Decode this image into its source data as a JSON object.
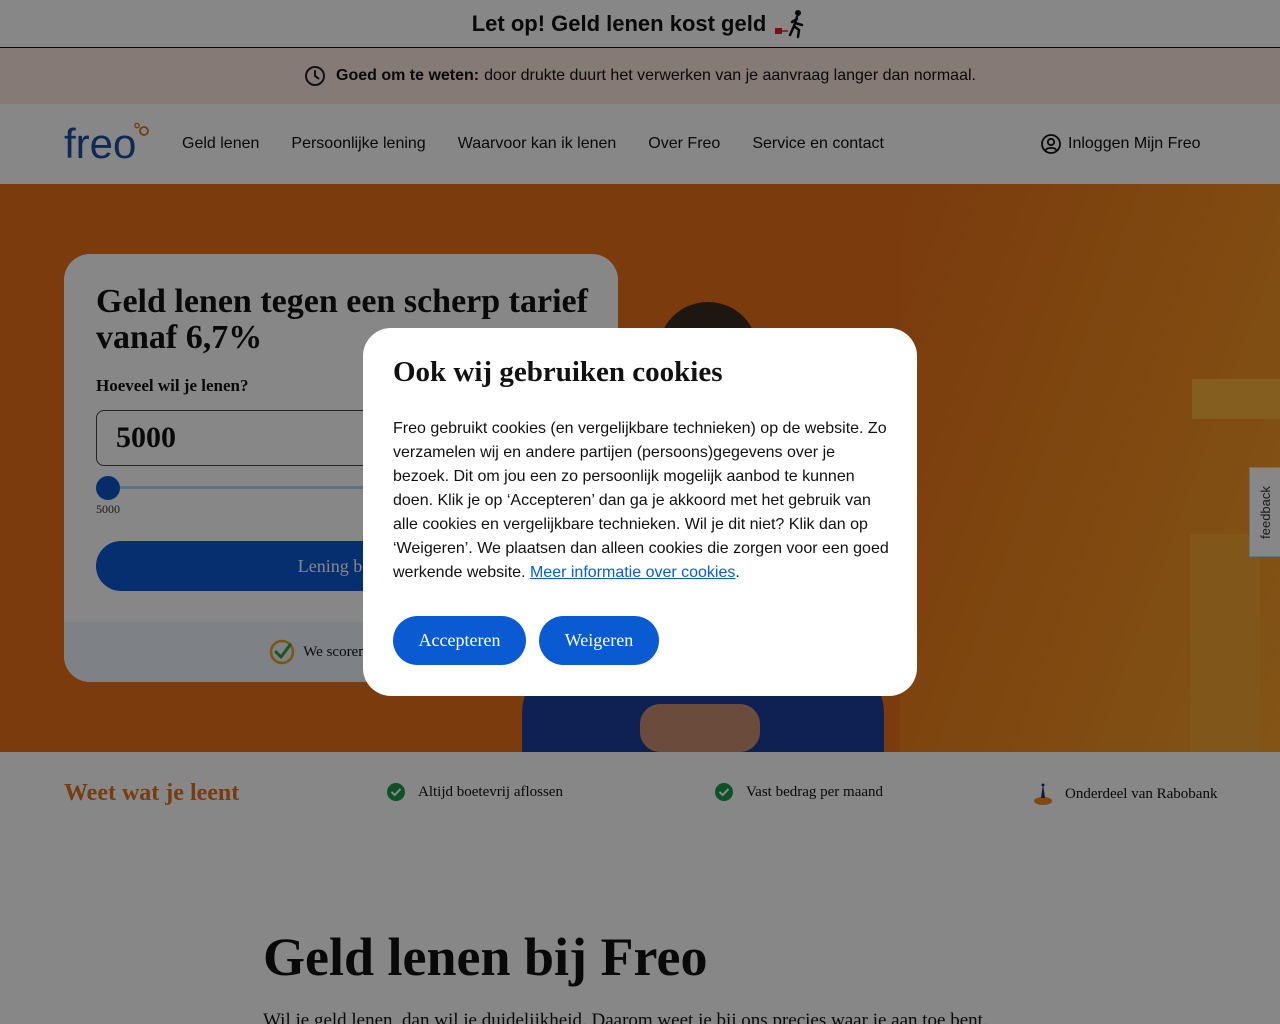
{
  "topbar": {
    "warning": "Let op! Geld lenen kost geld"
  },
  "notice": {
    "bold": "Goed om te weten:",
    "text": "door drukte duurt het verwerken van je aanvraag langer dan normaal."
  },
  "nav": {
    "logo_text": "freo",
    "items": [
      "Geld lenen",
      "Persoonlijke lening",
      "Waarvoor kan ik lenen",
      "Over Freo",
      "Service en contact"
    ],
    "login": "Inloggen Mijn Freo"
  },
  "calculator": {
    "title": "Geld lenen tegen een scherp tarief vanaf 6,7%",
    "amount_label": "Hoeveel wil je lenen?",
    "amount_value": "5000",
    "slider_min_label": "5000",
    "button": "Lening bere",
    "rating_text": "We scoren een 8,5"
  },
  "usp": {
    "title": "Weet wat je leent",
    "items": [
      "Altijd boetevrij aflossen",
      "Vast bedrag per maand",
      "Onderdeel van Rabobank"
    ]
  },
  "main": {
    "heading": "Geld lenen bij Freo",
    "intro": "Wil je geld lenen, dan wil je duidelijkheid. Daarom weet je bij ons precies waar je aan toe bent."
  },
  "feedback": "feedback",
  "cookie_modal": {
    "title": "Ook wij gebruiken cookies",
    "body": "Freo gebruikt cookies (en vergelijkbare technieken) op de website. Zo verzamelen wij en andere partijen (persoons)gegevens over je bezoek. Dit om jou een zo persoonlijk mogelijk aanbod te kunnen doen. Klik je op ‘Accepteren’ dan ga je akkoord met het gebruik van alle cookies en vergelijkbare technieken. Wil je dit niet? Klik dan op ‘Weigeren’. We plaatsen dan alleen cookies die zorgen voor een goed werkende website.",
    "link": "Meer informatie over cookies",
    "accept": "Accepteren",
    "reject": "Weigeren"
  },
  "colors": {
    "brand_blue": "#0a5ad2",
    "hero_orange": "#e8701a",
    "accent_orange": "#e37222",
    "notice_bg": "#fbe6de"
  }
}
